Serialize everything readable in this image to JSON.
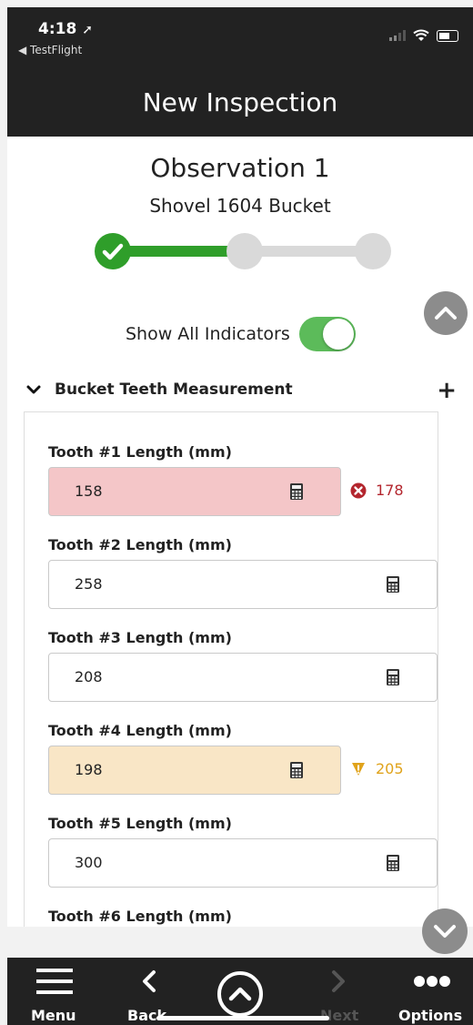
{
  "status_bar": {
    "time": "4:18",
    "back_app_label": "◀ TestFlight",
    "location_icon": "location-arrow-icon",
    "signal_icon": "signal-icon",
    "wifi_icon": "wifi-icon",
    "battery_icon": "battery-icon"
  },
  "header": {
    "title": "New Inspection"
  },
  "observation": {
    "title": "Observation 1",
    "subtitle": "Shovel 1604 Bucket",
    "progress": {
      "steps": 3,
      "current_step": 1,
      "accent": "#2f9e2a"
    }
  },
  "indicators_toggle": {
    "label": "Show All Indicators",
    "on": true
  },
  "section": {
    "title": "Bucket Teeth Measurement",
    "expanded": true
  },
  "fields": [
    {
      "label": "Tooth #1 Length (mm)",
      "value": "158",
      "status": "error",
      "indicator_value": "178",
      "color": "#b3262e"
    },
    {
      "label": "Tooth #2 Length (mm)",
      "value": "258",
      "status": "normal"
    },
    {
      "label": "Tooth #3 Length (mm)",
      "value": "208",
      "status": "normal"
    },
    {
      "label": "Tooth #4 Length (mm)",
      "value": "198",
      "status": "warning",
      "indicator_value": "205",
      "color": "#e0a31c"
    },
    {
      "label": "Tooth #5 Length (mm)",
      "value": "300",
      "status": "normal"
    },
    {
      "label": "Tooth #6 Length (mm)",
      "status": "normal"
    }
  ],
  "bottom_bar": {
    "menu": "Menu",
    "back": "Back",
    "next": "Next",
    "options": "Options"
  }
}
